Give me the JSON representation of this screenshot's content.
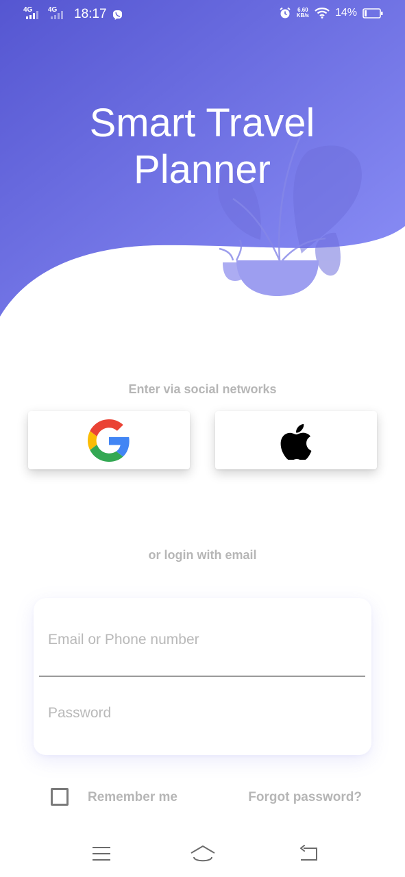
{
  "status_bar": {
    "network_1": "4G",
    "network_2": "4G",
    "time": "18:17",
    "speed_value": "6.60",
    "speed_unit": "KB/s",
    "battery": "14%",
    "battery_level": 0.14,
    "icons": [
      "signal-icon",
      "signal-icon",
      "viber-icon",
      "alarm-icon",
      "wifi-icon",
      "battery-icon"
    ]
  },
  "header": {
    "title": "Smart Travel Planner",
    "illustration": "plant-pot-illustration"
  },
  "social": {
    "label": "Enter via social networks",
    "buttons": [
      {
        "icon": "google-icon"
      },
      {
        "icon": "apple-icon"
      }
    ]
  },
  "email_login": {
    "label": "or login with email",
    "email_placeholder": "Email or Phone number",
    "email_value": "",
    "password_placeholder": "Password",
    "password_value": ""
  },
  "options": {
    "remember_label": "Remember me",
    "remember_checked": false,
    "forgot_label": "Forgot password?"
  },
  "nav_bar": {
    "icons": [
      "menu-icon",
      "home-icon",
      "back-icon"
    ]
  },
  "colors": {
    "gradient_start": "#5556d1",
    "gradient_end": "#8b8ff6",
    "plant": "#9d9ef0",
    "label_gray": "#b6b6b6",
    "status_text": "#ffffff"
  }
}
